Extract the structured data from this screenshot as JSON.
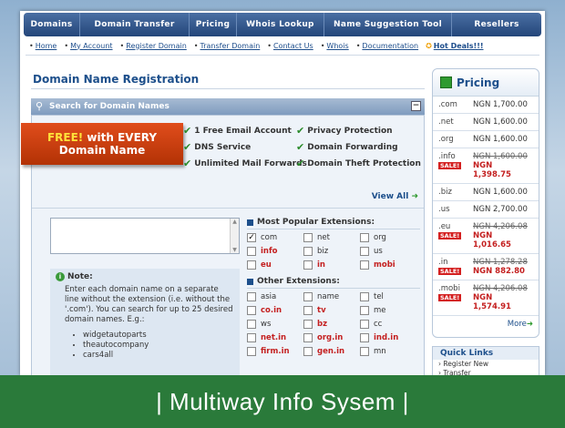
{
  "topnav": [
    "Domains",
    "Domain Transfer",
    "Pricing",
    "Whois Lookup",
    "Name Suggestion Tool",
    "Resellers"
  ],
  "subnav": [
    "Home",
    "My Account",
    "Register Domain",
    "Transfer Domain",
    "Contact Us",
    "Whois",
    "Documentation"
  ],
  "hot_deals": "Hot Deals!!!",
  "page_title": "Domain Name Registration",
  "search_title": "Search for Domain Names",
  "banner": {
    "free": "FREE!",
    "line1_rest": " with EVERY",
    "line2": "Domain Name"
  },
  "features": [
    "1 Free Email Account",
    "Privacy Protection",
    "DNS Service",
    "Domain Forwarding",
    "Unlimited Mail Forwards",
    "Domain Theft Protection"
  ],
  "view_all": "View All",
  "note": {
    "title": "Note:",
    "text": "Enter each domain name on a separate line without the extension (i.e. without the '.com'). You can search for up to 25 desired domain names. E.g.:",
    "examples": [
      "widgetautoparts",
      "theautocompany",
      "cars4all"
    ]
  },
  "popular_title": "Most Popular Extensions:",
  "popular": [
    {
      "name": "com",
      "checked": true,
      "red": false
    },
    {
      "name": "net",
      "checked": false,
      "red": false
    },
    {
      "name": "org",
      "checked": false,
      "red": false
    },
    {
      "name": "info",
      "checked": false,
      "red": true
    },
    {
      "name": "biz",
      "checked": false,
      "red": false
    },
    {
      "name": "us",
      "checked": false,
      "red": false
    },
    {
      "name": "eu",
      "checked": false,
      "red": true
    },
    {
      "name": "in",
      "checked": false,
      "red": true
    },
    {
      "name": "mobi",
      "checked": false,
      "red": true
    }
  ],
  "other_title": "Other Extensions:",
  "other": [
    {
      "name": "asia",
      "red": false
    },
    {
      "name": "name",
      "red": false
    },
    {
      "name": "tel",
      "red": false
    },
    {
      "name": "co.in",
      "red": true
    },
    {
      "name": "tv",
      "red": true
    },
    {
      "name": "me",
      "red": false
    },
    {
      "name": "ws",
      "red": false
    },
    {
      "name": "bz",
      "red": true
    },
    {
      "name": "cc",
      "red": false
    },
    {
      "name": "net.in",
      "red": true
    },
    {
      "name": "org.in",
      "red": true
    },
    {
      "name": "ind.in",
      "red": true
    },
    {
      "name": "firm.in",
      "red": true
    },
    {
      "name": "gen.in",
      "red": true
    },
    {
      "name": "mn",
      "red": false
    }
  ],
  "pricing_title": "Pricing",
  "pricing": [
    {
      "ext": ".com",
      "price": "NGN 1,700.00"
    },
    {
      "ext": ".net",
      "price": "NGN 1,600.00"
    },
    {
      "ext": ".org",
      "price": "NGN 1,600.00"
    },
    {
      "ext": ".info",
      "sale": "SALE!",
      "old": "NGN 1,600.00",
      "new_prefix": "NGN",
      "new": "1,398.75"
    },
    {
      "ext": ".biz",
      "price": "NGN 1,600.00"
    },
    {
      "ext": ".us",
      "price": "NGN 2,700.00"
    },
    {
      "ext": ".eu",
      "sale": "SALE!",
      "old": "NGN 4,206.08",
      "new_prefix": "NGN",
      "new": "1,016.65"
    },
    {
      "ext": ".in",
      "sale": "SALE!",
      "old": "NGN 1,278.28",
      "new_prefix": "",
      "new": "NGN 882.80"
    },
    {
      "ext": ".mobi",
      "sale": "SALE!",
      "old": "NGN 4,206.08",
      "new_prefix": "NGN",
      "new": "1,574.91"
    }
  ],
  "more": "More",
  "quick_links_title": "Quick Links",
  "quick_links": [
    "Register New",
    "Transfer"
  ],
  "footer": "| Multiway Info Sysem |"
}
